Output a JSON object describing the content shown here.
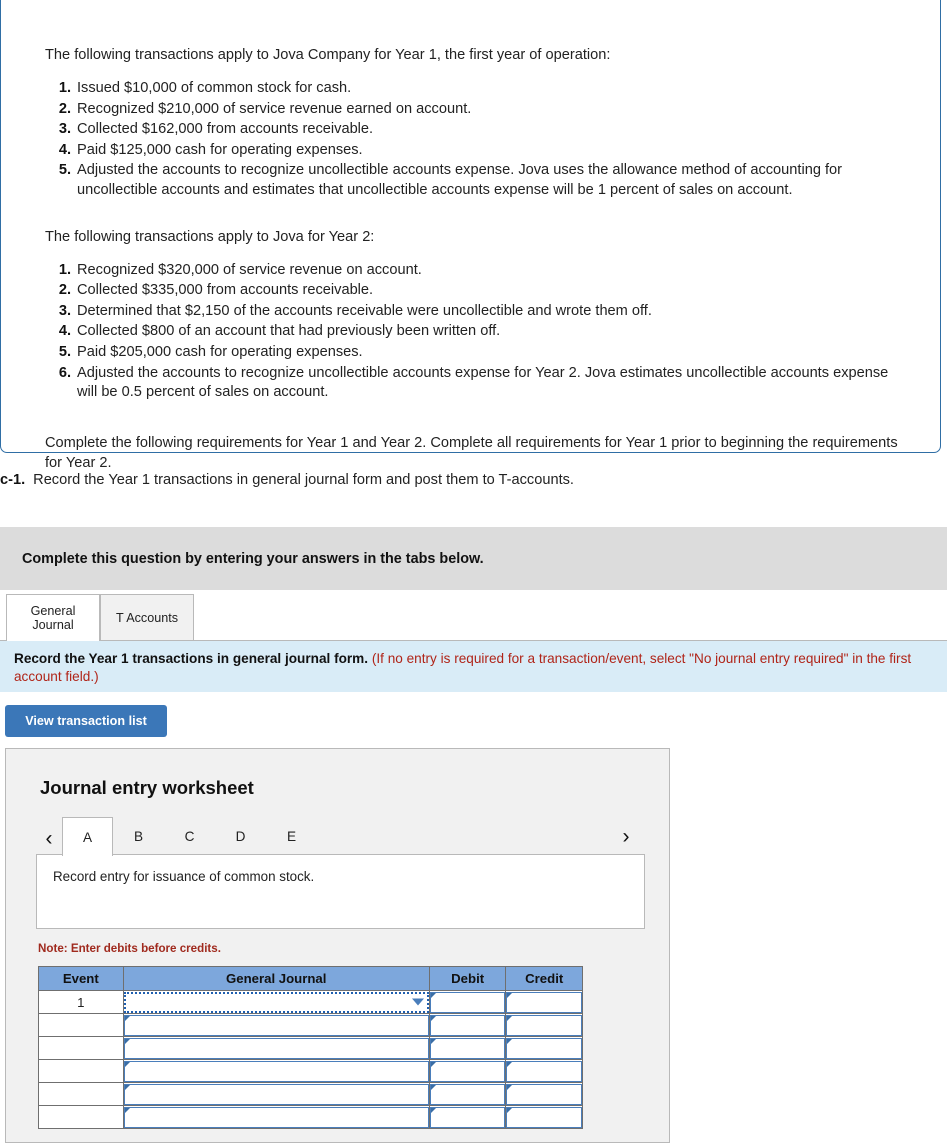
{
  "problem": {
    "cut_top_line": "a partially visible line of text cut off at the top of the viewport",
    "year1_intro": "The following transactions apply to Jova Company for Year 1, the first year of operation:",
    "year1_items": [
      "Issued $10,000 of common stock for cash.",
      "Recognized $210,000 of service revenue earned on account.",
      "Collected $162,000 from accounts receivable.",
      "Paid $125,000 cash for operating expenses.",
      "Adjusted the accounts to recognize uncollectible accounts expense. Jova uses the allowance method of accounting for uncollectible accounts and estimates that uncollectible accounts expense will be 1 percent of sales on account."
    ],
    "year2_intro": "The following transactions apply to Jova for Year 2:",
    "year2_items": [
      "Recognized $320,000 of service revenue on account.",
      "Collected $335,000 from accounts receivable.",
      "Determined that $2,150 of the accounts receivable were uncollectible and wrote them off.",
      "Collected $800 of an account that had previously been written off.",
      "Paid $205,000 cash for operating expenses.",
      "Adjusted the accounts to recognize uncollectible accounts expense for Year 2. Jova estimates uncollectible accounts expense will be 0.5 percent of sales on account."
    ],
    "closing": "Complete the following requirements for Year 1 and Year 2. Complete all requirements for Year 1 prior to beginning the requirements for Year 2."
  },
  "requirement": {
    "label": "c-1.",
    "text": "Record the Year 1 transactions in general journal form and post them to T-accounts."
  },
  "gray_banner": {
    "text": "Complete this question by entering your answers in the tabs below."
  },
  "main_tabs": [
    {
      "label": "General Journal",
      "line1": "General",
      "line2": "Journal",
      "active": true
    },
    {
      "label": "T Accounts",
      "line1": "T Accounts",
      "line2": "",
      "active": false
    }
  ],
  "blue_strip": {
    "bold_text": "Record the Year 1 transactions in general journal form.",
    "red_text": "(If no entry is required for a transaction/event, select \"No journal entry required\" in the first account field.)"
  },
  "view_transaction_button": {
    "label": "View transaction list"
  },
  "worksheet": {
    "title": "Journal entry worksheet",
    "prev_arrow": "‹",
    "next_arrow": "›",
    "letter_tabs": [
      "A",
      "B",
      "C",
      "D",
      "E"
    ],
    "active_letter_tab": "A",
    "description": "Record entry for issuance of common stock.",
    "note": "Note: Enter debits before credits."
  },
  "journal_table": {
    "headers": [
      "Event",
      "General Journal",
      "Debit",
      "Credit"
    ],
    "rows": [
      {
        "event": "1",
        "general_journal": "",
        "debit": "",
        "credit": "",
        "selected": true
      },
      {
        "event": "",
        "general_journal": "",
        "debit": "",
        "credit": "",
        "selected": false
      },
      {
        "event": "",
        "general_journal": "",
        "debit": "",
        "credit": "",
        "selected": false
      },
      {
        "event": "",
        "general_journal": "",
        "debit": "",
        "credit": "",
        "selected": false
      },
      {
        "event": "",
        "general_journal": "",
        "debit": "",
        "credit": "",
        "selected": false
      },
      {
        "event": "",
        "general_journal": "",
        "debit": "",
        "credit": "",
        "selected": false
      }
    ]
  },
  "colors": {
    "card_border": "#2f6ea5",
    "gray_banner_bg": "#dcdcdc",
    "blue_strip_bg": "#d9ecf7",
    "red_text": "#b02418",
    "primary_button": "#3b77b8",
    "table_header_blue": "#7da7dc",
    "field_border": "#4a7ebb"
  }
}
